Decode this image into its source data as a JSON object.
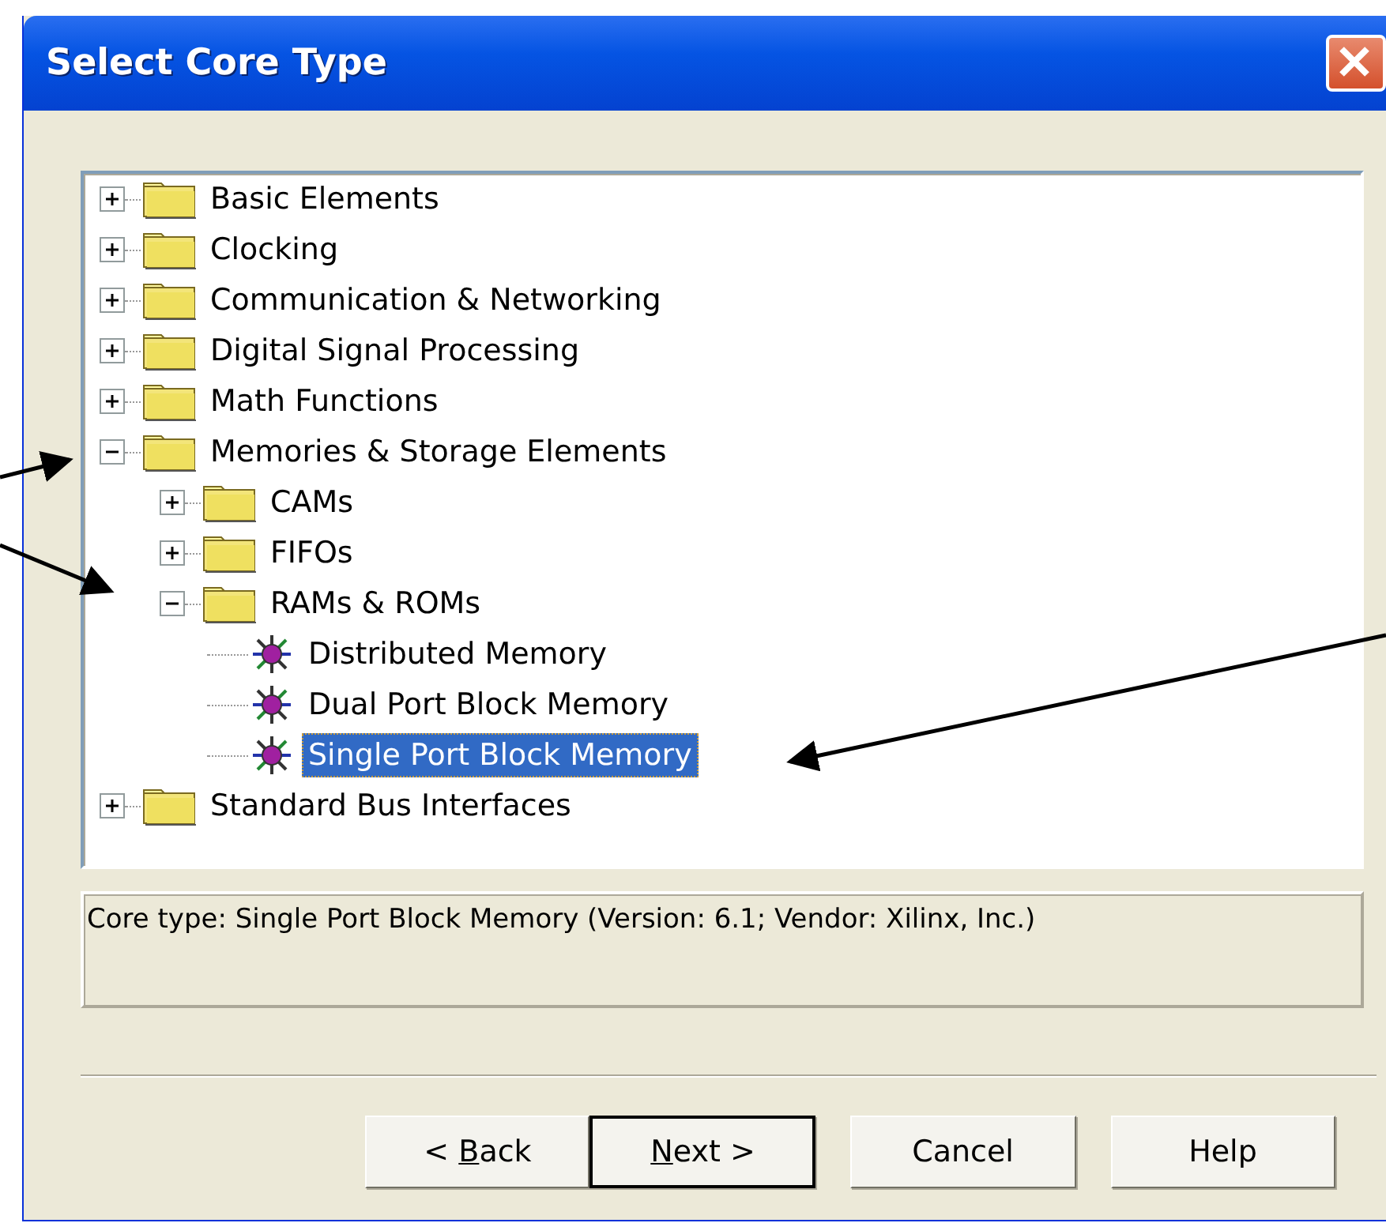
{
  "window": {
    "title": "Select Core Type"
  },
  "tree": [
    {
      "label": "Basic Elements",
      "kind": "folder",
      "expanded": false,
      "selected": false
    },
    {
      "label": "Clocking",
      "kind": "folder",
      "expanded": false,
      "selected": false
    },
    {
      "label": "Communication & Networking",
      "kind": "folder",
      "expanded": false,
      "selected": false
    },
    {
      "label": "Digital Signal Processing",
      "kind": "folder",
      "expanded": false,
      "selected": false
    },
    {
      "label": "Math Functions",
      "kind": "folder",
      "expanded": false,
      "selected": false
    },
    {
      "label": "Memories & Storage Elements",
      "kind": "folder",
      "expanded": true,
      "selected": false,
      "children": [
        {
          "label": "CAMs",
          "kind": "folder",
          "expanded": false,
          "selected": false
        },
        {
          "label": "FIFOs",
          "kind": "folder",
          "expanded": false,
          "selected": false
        },
        {
          "label": "RAMs & ROMs",
          "kind": "folder",
          "expanded": true,
          "selected": false,
          "children": [
            {
              "label": "Distributed Memory",
              "kind": "core",
              "selected": false
            },
            {
              "label": "Dual Port Block Memory",
              "kind": "core",
              "selected": false
            },
            {
              "label": "Single Port Block Memory",
              "kind": "core",
              "selected": true
            }
          ]
        }
      ]
    },
    {
      "label": "Standard Bus Interfaces",
      "kind": "folder",
      "expanded": false,
      "selected": false
    }
  ],
  "description": "Core type: Single Port Block Memory (Version: 6.1; Vendor: Xilinx, Inc.)",
  "buttons": [
    {
      "before": "< ",
      "key": "B",
      "after": "ack",
      "default": false
    },
    {
      "key": "N",
      "after": "ext >",
      "default": true
    },
    {
      "before": "Cancel",
      "default": false
    },
    {
      "before": "Help",
      "default": false
    }
  ]
}
